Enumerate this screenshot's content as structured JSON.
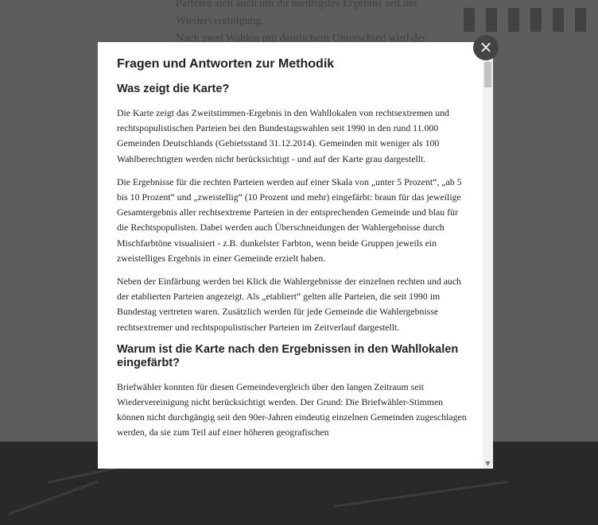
{
  "background": {
    "text_lines": [
      "Parteien sich auch um ihr niedrigstes Ergebnis seit der",
      "Wiedervereinigung.",
      "Nach zwei Wahlen mit deutlichem Unterschied wird der"
    ]
  },
  "modal": {
    "title": "Fragen und Antworten zur Methodik",
    "close_label": "×",
    "sections": [
      {
        "heading": "Was zeigt die Karte?",
        "paragraphs": [
          "Die Karte zeigt das Zweitstimmen-Ergebnis in den Wahllokalen von rechtsextremen und rechtspopulistischen Parteien bei den Bundestagswahlen seit 1990 in den rund 11.000 Gemeinden Deutschlands (Gebietsstand 31.12.2014). Gemeinden mit weniger als 100 Wahlberechtigten werden nicht berücksichtigt - und auf der Karte grau dargestellt.",
          "Die Ergebnisse für die rechten Parteien werden auf einer Skala von „unter 5 Prozent“, „ab 5 bis 10 Prozent“ und „zweistellig“ (10 Prozent und mehr) eingefärbt: braun für das jeweilige Gesamtergebnis aller rechtsextreme Parteien in der entsprechenden Gemeinde und blau für die Rechtspopulisten. Dabei werden auch Überschneidungen der Wahlergebnisse durch Mischfarbtöne visualisiert - z.B. dunkelster Farbton, wenn beide Gruppen jeweils ein zweistelliges Ergebnis in einer Gemeinde erzielt haben.",
          "Neben der Einfärbung werden bei Klick die Wahlergebnisse der einzelnen rechten und auch der etablierten Parteien angezeigt. Als „etabliert“ gelten alle Parteien, die seit 1990 im Bundestag vertreten waren. Zusätzlich werden für jede Gemeinde die Wahlergebnisse rechtsextremer und rechtspopulistischer Parteien im Zeitverlauf dargestellt."
        ]
      },
      {
        "heading": "Warum ist die Karte nach den Ergebnissen in den Wahllokalen eingefärbt?",
        "paragraphs": [
          "Briefwähler konnten für diesen Gemeindevergleich über den langen Zeitraum seit Wiedervereinigung nicht berücksichtigt werden. Der Grund: Die Briefwähler-Stimmen können nicht durchgängig seit den 90er-Jahren eindeutig einzelnen Gemeinden zugeschlagen werden, da sie zum Teil auf einer höheren geografischen"
        ]
      }
    ]
  },
  "scrollbar": {
    "up_icon": "▲",
    "down_icon": "▼"
  }
}
